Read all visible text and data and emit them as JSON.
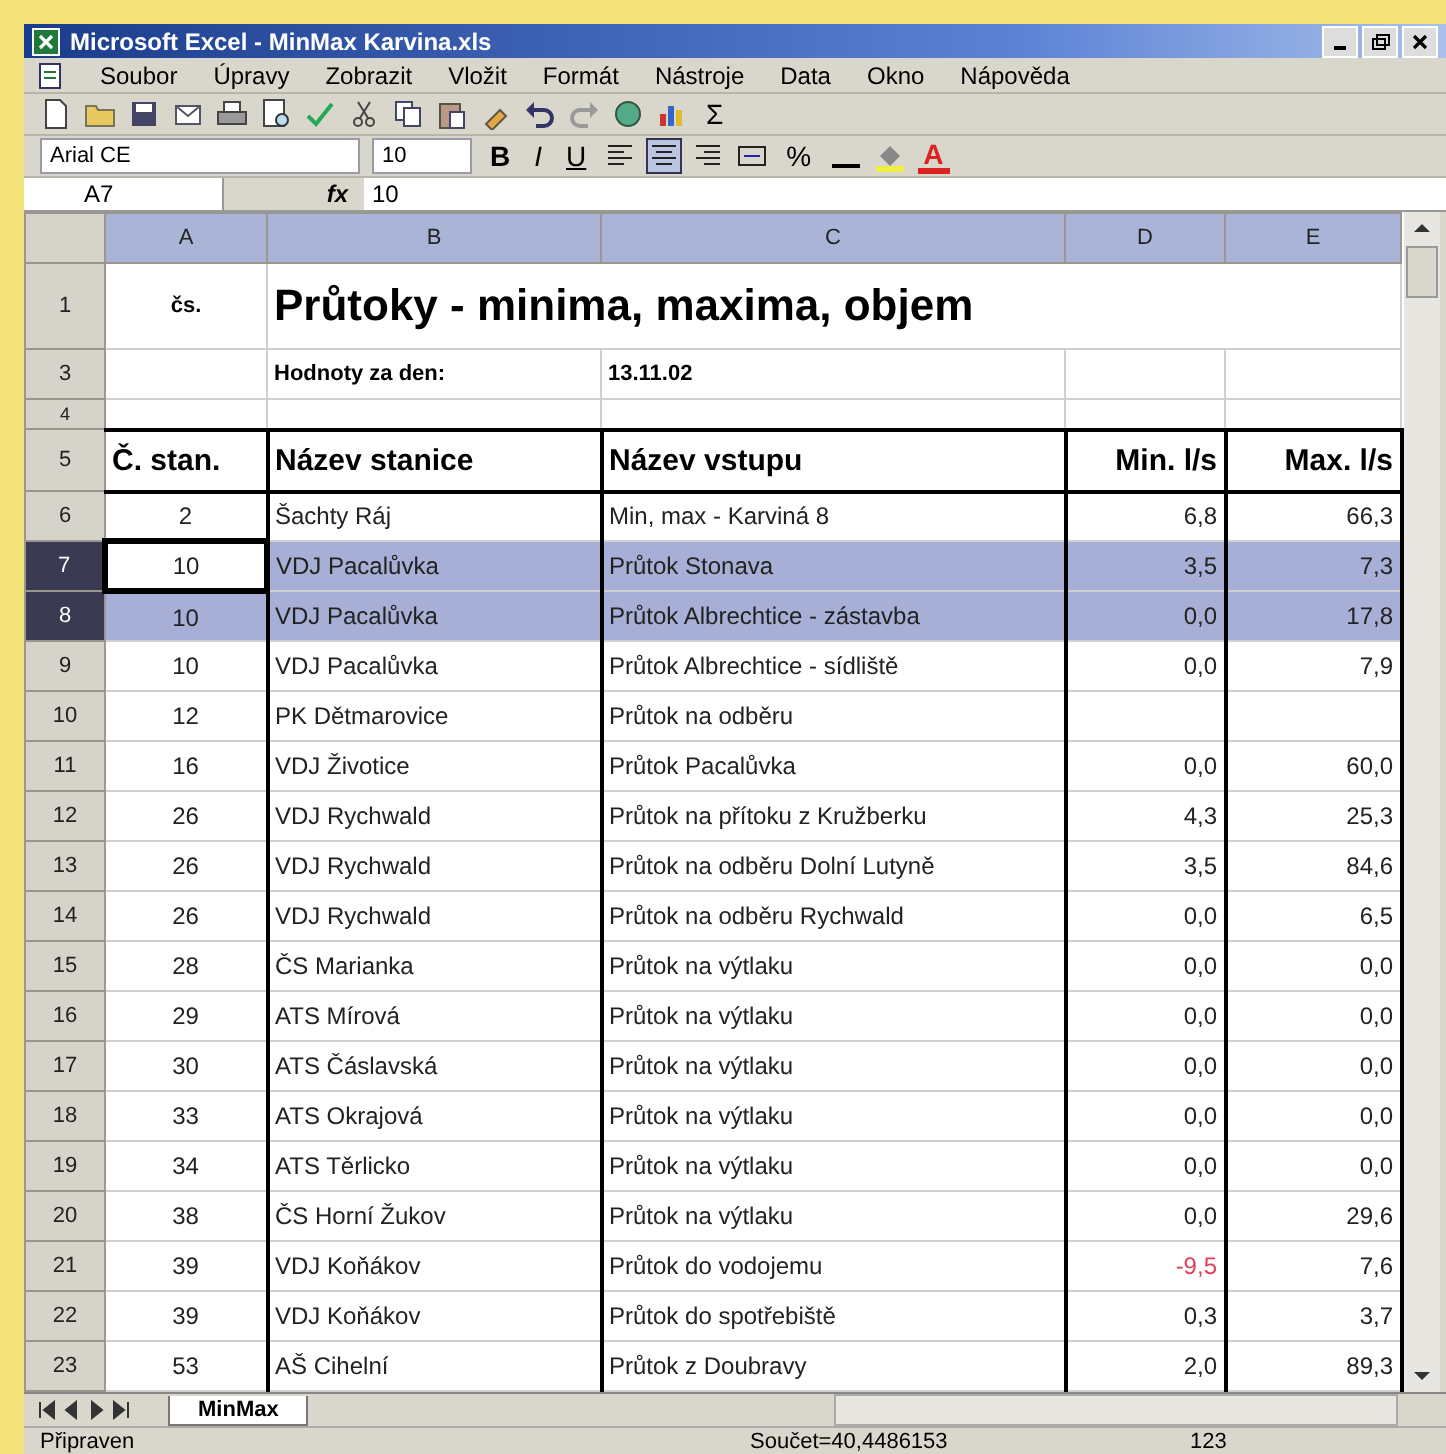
{
  "window": {
    "title": "Microsoft Excel - MinMax Karvina.xls"
  },
  "menu": [
    "Soubor",
    "Úpravy",
    "Zobrazit",
    "Vložit",
    "Formát",
    "Nástroje",
    "Data",
    "Okno",
    "Nápověda"
  ],
  "standard_toolbar": {
    "sum_label": "Σ"
  },
  "formatting_toolbar": {
    "font": "Arial CE",
    "size": "10",
    "bold_label": "B",
    "italic_label": "I",
    "underline_label": "U",
    "percent_label": "%",
    "font_color_label": "A"
  },
  "formula_bar": {
    "name_box": "A7",
    "fx_label": "fx",
    "formula": "10"
  },
  "sheet": {
    "columns": [
      {
        "label": "A",
        "selected": false
      },
      {
        "label": "B",
        "selected": false
      },
      {
        "label": "C",
        "selected": false
      },
      {
        "label": "D",
        "selected": false
      },
      {
        "label": "E",
        "selected": false
      }
    ],
    "rows": [
      {
        "kind": "title",
        "header": "1",
        "col_a": "čs.",
        "title": "Průtoky - minima, maxima, objem"
      },
      {
        "kind": "info",
        "header": "3",
        "label": "Hodnoty za den:",
        "value": "13.11.02"
      },
      {
        "kind": "blank",
        "header": "4"
      },
      {
        "kind": "header",
        "header": "5",
        "cells": [
          "Č. stan.",
          "Název stanice",
          "Název vstupu",
          "Min. l/s",
          "Max. l/s"
        ]
      },
      {
        "kind": "data",
        "header": "6",
        "selected": false,
        "active": false,
        "negative": false,
        "cells": [
          "2",
          "Šachty Ráj",
          "Min, max - Karviná 8",
          "6,8",
          "66,3"
        ]
      },
      {
        "kind": "data",
        "header": "7",
        "selected": true,
        "active": true,
        "negative": false,
        "cells": [
          "10",
          "VDJ Pacalůvka",
          "Průtok Stonava",
          "3,5",
          "7,3"
        ]
      },
      {
        "kind": "data",
        "header": "8",
        "selected": true,
        "active": false,
        "negative": false,
        "cells": [
          "10",
          "VDJ Pacalůvka",
          "Průtok Albrechtice - zástavba",
          "0,0",
          "17,8"
        ]
      },
      {
        "kind": "data",
        "header": "9",
        "selected": false,
        "active": false,
        "negative": false,
        "cells": [
          "10",
          "VDJ Pacalůvka",
          "Průtok Albrechtice - sídliště",
          "0,0",
          "7,9"
        ]
      },
      {
        "kind": "data",
        "header": "10",
        "selected": false,
        "active": false,
        "negative": false,
        "cells": [
          "12",
          "PK Dětmarovice",
          "Průtok na odběru",
          "",
          ""
        ]
      },
      {
        "kind": "data",
        "header": "11",
        "selected": false,
        "active": false,
        "negative": false,
        "cells": [
          "16",
          "VDJ Životice",
          "Průtok Pacalůvka",
          "0,0",
          "60,0"
        ]
      },
      {
        "kind": "data",
        "header": "12",
        "selected": false,
        "active": false,
        "negative": false,
        "cells": [
          "26",
          "VDJ Rychwald",
          "Průtok na přítoku z Kružberku",
          "4,3",
          "25,3"
        ]
      },
      {
        "kind": "data",
        "header": "13",
        "selected": false,
        "active": false,
        "negative": false,
        "cells": [
          "26",
          "VDJ Rychwald",
          "Průtok na odběru Dolní Lutyně",
          "3,5",
          "84,6"
        ]
      },
      {
        "kind": "data",
        "header": "14",
        "selected": false,
        "active": false,
        "negative": false,
        "cells": [
          "26",
          "VDJ Rychwald",
          "Průtok na odběru Rychwald",
          "0,0",
          "6,5"
        ]
      },
      {
        "kind": "data",
        "header": "15",
        "selected": false,
        "active": false,
        "negative": false,
        "cells": [
          "28",
          "ČS Marianka",
          "Průtok na výtlaku",
          "0,0",
          "0,0"
        ]
      },
      {
        "kind": "data",
        "header": "16",
        "selected": false,
        "active": false,
        "negative": false,
        "cells": [
          "29",
          "ATS Mírová",
          "Průtok na výtlaku",
          "0,0",
          "0,0"
        ]
      },
      {
        "kind": "data",
        "header": "17",
        "selected": false,
        "active": false,
        "negative": false,
        "cells": [
          "30",
          "ATS Čáslavská",
          "Průtok na výtlaku",
          "0,0",
          "0,0"
        ]
      },
      {
        "kind": "data",
        "header": "18",
        "selected": false,
        "active": false,
        "negative": false,
        "cells": [
          "33",
          "ATS Okrajová",
          "Průtok na výtlaku",
          "0,0",
          "0,0"
        ]
      },
      {
        "kind": "data",
        "header": "19",
        "selected": false,
        "active": false,
        "negative": false,
        "cells": [
          "34",
          "ATS Těrlicko",
          "Průtok na výtlaku",
          "0,0",
          "0,0"
        ]
      },
      {
        "kind": "data",
        "header": "20",
        "selected": false,
        "active": false,
        "negative": false,
        "cells": [
          "38",
          "ČS Horní Žukov",
          "Průtok na výtlaku",
          "0,0",
          "29,6"
        ]
      },
      {
        "kind": "data",
        "header": "21",
        "selected": false,
        "active": false,
        "negative": true,
        "cells": [
          "39",
          "VDJ Koňákov",
          "Průtok do vodojemu",
          "-9,5",
          "7,6"
        ]
      },
      {
        "kind": "data",
        "header": "22",
        "selected": false,
        "active": false,
        "negative": false,
        "cells": [
          "39",
          "VDJ Koňákov",
          "Průtok do spotřebiště",
          "0,3",
          "3,7"
        ]
      },
      {
        "kind": "data",
        "header": "23",
        "selected": false,
        "active": false,
        "negative": false,
        "cells": [
          "53",
          "AŠ Cihelní",
          "Průtok z Doubravy",
          "2,0",
          "89,3"
        ]
      }
    ]
  },
  "sheet_tabs": [
    {
      "label": "MinMax",
      "selected": true
    }
  ],
  "status_bar": {
    "state": "Připraven",
    "sum": "Součet=40,4486153",
    "count": "123"
  }
}
